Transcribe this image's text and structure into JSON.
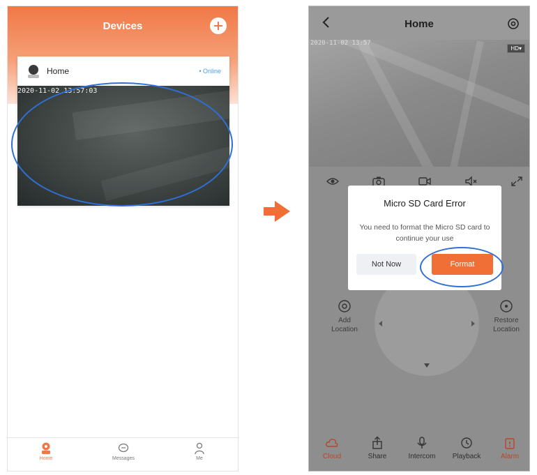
{
  "left_screen": {
    "title": "Devices",
    "device": {
      "name": "Home",
      "status": "• Online",
      "timestamp": "2020-11-02 13:57:03"
    },
    "tabs": [
      {
        "label": "Home",
        "icon": "camera-home-icon",
        "active": true
      },
      {
        "label": "Messages",
        "icon": "message-icon",
        "active": false
      },
      {
        "label": "Me",
        "icon": "user-icon",
        "active": false
      }
    ]
  },
  "right_screen": {
    "title": "Home",
    "video": {
      "quality_badge": "HD▾",
      "timestamp": "2020-11-02 13:57"
    },
    "controls": [
      "eye-icon",
      "snapshot-icon",
      "record-icon",
      "mute-icon",
      "fullscreen-icon"
    ],
    "ptz": {
      "add_location": "Add\nLocation",
      "restore_location": "Restore\nLocation"
    },
    "dialog": {
      "title": "Micro SD Card Error",
      "message": "You need to format the Micro SD card to continue your use",
      "cancel_label": "Not Now",
      "confirm_label": "Format"
    },
    "tabs": [
      {
        "label": "Cloud",
        "icon": "cloud-icon"
      },
      {
        "label": "Share",
        "icon": "share-icon"
      },
      {
        "label": "Intercom",
        "icon": "microphone-icon"
      },
      {
        "label": "Playback",
        "icon": "playback-icon"
      },
      {
        "label": "Alarm",
        "icon": "alarm-icon"
      }
    ]
  },
  "colors": {
    "accent": "#f07845",
    "highlight": "#2f6fd6",
    "format_button": "#f06f36"
  }
}
